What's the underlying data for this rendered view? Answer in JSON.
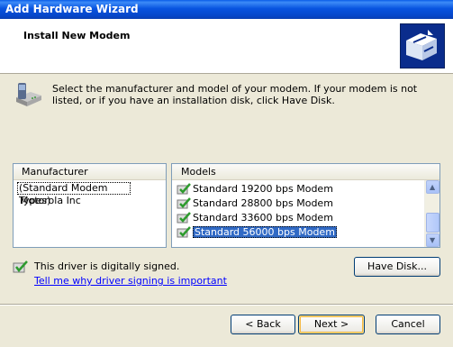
{
  "window": {
    "title": "Add Hardware Wizard"
  },
  "header": {
    "title": "Install New Modem",
    "icon": "modem-wizard-icon"
  },
  "intro": {
    "icon": "modem-phone-icon",
    "text": "Select the manufacturer and model of your modem. If your modem is not listed, or if you have an installation disk, click Have Disk."
  },
  "manufacturer_list": {
    "header": "Manufacturer",
    "items": [
      "(Standard Modem Types)",
      "Motorola Inc"
    ],
    "selected_index": 0
  },
  "models_list": {
    "header": "Models",
    "items": [
      "Standard 19200 bps Modem",
      "Standard 28800 bps Modem",
      "Standard 33600 bps Modem",
      "Standard 56000 bps Modem"
    ],
    "selected_index": 3
  },
  "signature": {
    "icon": "signed-driver-icon",
    "text": "This driver is digitally signed.",
    "link": "Tell me why driver signing is important"
  },
  "buttons": {
    "have_disk": {
      "label": "Have Disk...",
      "mnemonic": "H"
    },
    "back": {
      "label": "< Back",
      "mnemonic": "B"
    },
    "next": {
      "label": "Next >",
      "mnemonic": "N"
    },
    "cancel": {
      "label": "Cancel"
    }
  },
  "colors": {
    "titlebar": "#0854E0",
    "selection": "#316AC5",
    "link": "#0000FF",
    "dialog_bg": "#ECE9D8"
  }
}
